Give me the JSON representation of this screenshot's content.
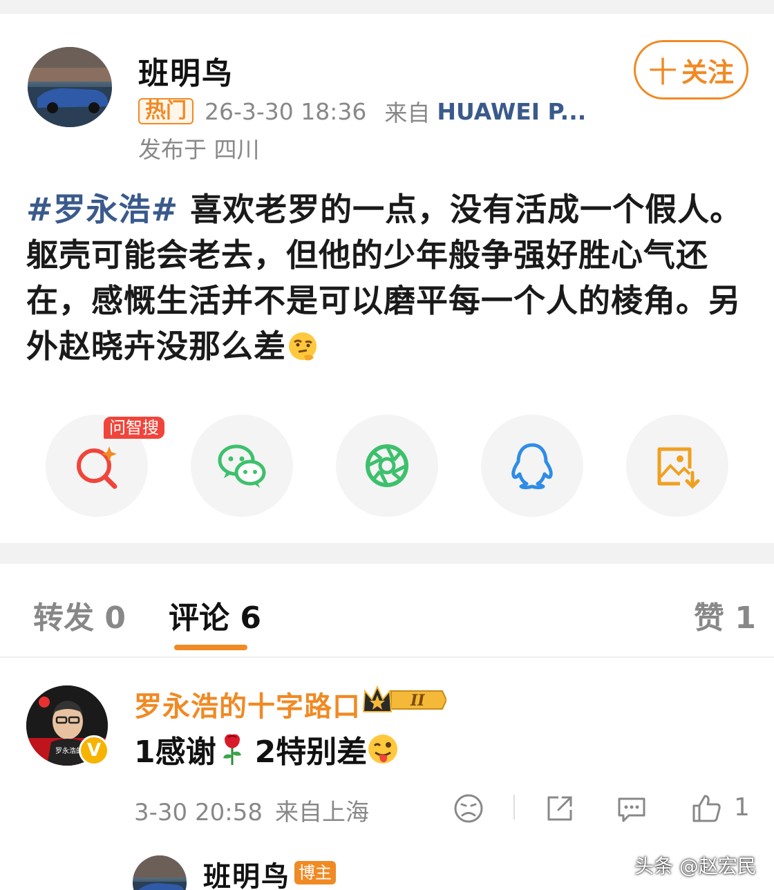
{
  "post": {
    "author": "班明鸟",
    "follow_plus": "十",
    "follow_label": "关注",
    "hot_badge": "热门",
    "time": "26-3-30 18:36",
    "from_label": "来自",
    "device": "HUAWEI P...",
    "location": "发布于 四川",
    "topic": "#罗永浩#",
    "text": " 喜欢老罗的一点，没有活成一个假人。躯壳可能会老去，但他的少年般争强好胜心气还在，感慨生活并不是可以磨平每一个人的棱角。另外赵晓卉没那么差",
    "emoji": "thinking-face-emoji"
  },
  "share": {
    "ai_tag": "问智搜",
    "items": [
      "ai-search-icon",
      "wechat-icon",
      "moments-icon",
      "qq-icon",
      "save-image-icon"
    ]
  },
  "tabs": {
    "repost": "转发 0",
    "comments": "评论 6",
    "likes": "赞 1"
  },
  "comment": {
    "author": "罗永浩的十字路口",
    "level_badge": "II",
    "verified_mark": "V",
    "avatar_caption": "罗永浩的十字路口",
    "text_a": "1感谢",
    "text_b": "2特别差",
    "time": "3-30 20:58",
    "location": "来自上海",
    "like_count": "1"
  },
  "reply": {
    "author": "班明鸟",
    "badge": "博主"
  },
  "watermark": "头条 @赵宏民",
  "colors": {
    "accent": "#f08a24",
    "link": "#3a5a8c",
    "muted": "#888888",
    "wechat": "#3dc06c",
    "qq": "#2e8de6"
  }
}
